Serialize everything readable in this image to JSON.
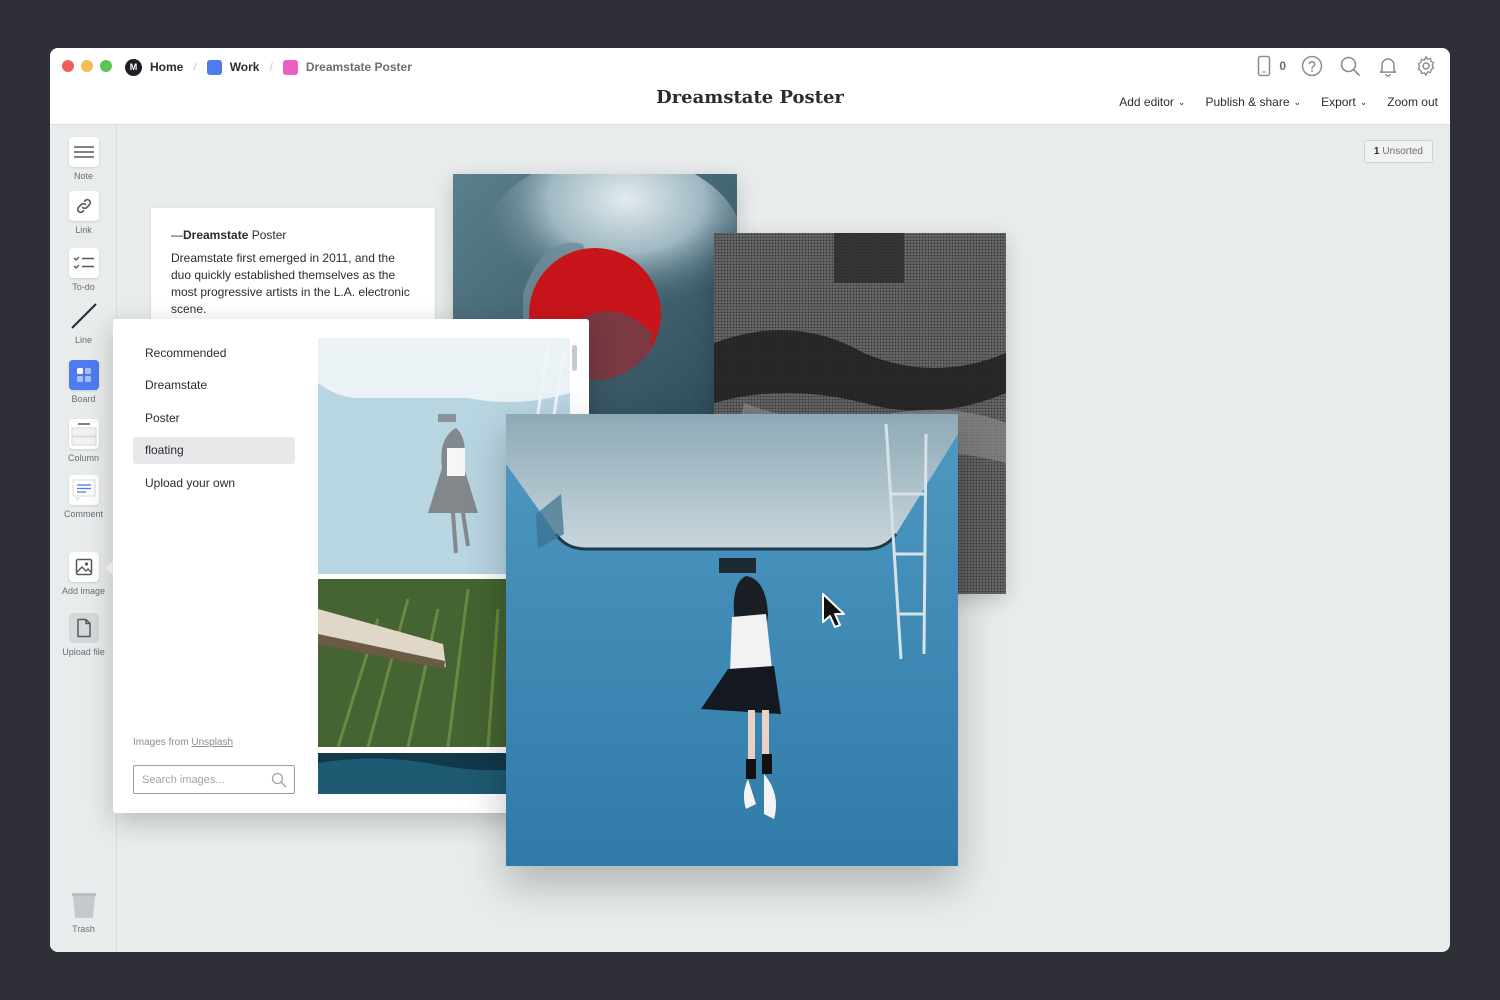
{
  "breadcrumbs": [
    {
      "label": "Home",
      "icon": "milanote-logo-icon"
    },
    {
      "label": "Work",
      "icon": "blue-board-icon",
      "color": "#4e7bee"
    },
    {
      "label": "Dreamstate Poster",
      "icon": "pink-board-icon",
      "color": "#ee5fc3"
    }
  ],
  "header": {
    "title": "Dreamstate Poster",
    "device_count": "0",
    "icons": [
      "mobile-device-icon",
      "help-icon",
      "search-icon",
      "bell-icon",
      "gear-icon"
    ]
  },
  "menu": {
    "add_editor": "Add editor",
    "publish_share": "Publish & share",
    "export": "Export",
    "zoom_out": "Zoom out"
  },
  "toolbar": {
    "note": "Note",
    "link": "Link",
    "todo": "To-do",
    "line": "Line",
    "board": "Board",
    "column": "Column",
    "comment": "Comment",
    "add_image": "Add image",
    "upload_file": "Upload file",
    "trash": "Trash"
  },
  "canvas": {
    "unsorted_count": "1",
    "unsorted_label": "Unsorted",
    "note": {
      "title_prefix": "—",
      "title_bold": "Dreamstate",
      "title_rest": " Poster",
      "body": "Dreamstate first emerged in 2011, and the duo quickly established themselves as the most progressive artists in the L.A. electronic scene."
    }
  },
  "image_picker": {
    "categories": [
      "Recommended",
      "Dreamstate",
      "Poster",
      "floating",
      "Upload your own"
    ],
    "selected": "floating",
    "source_prefix": "Images from ",
    "source_link": "Unsplash",
    "search_placeholder": "Search images..."
  },
  "colors": {
    "accent": "#4e7bee",
    "window_bg": "#e9ecec",
    "desktop_bg": "#2f2f38"
  }
}
